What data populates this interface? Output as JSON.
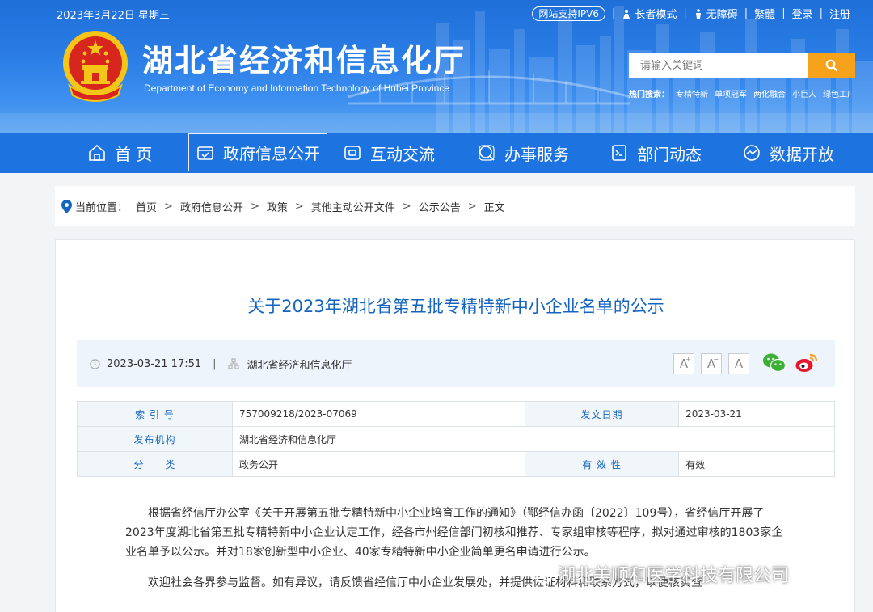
{
  "header": {
    "date": "2023年3月22日 星期三",
    "site_title": "湖北省经济和信息化厅",
    "site_subtitle": "Department of Economy and Information Technology of Hubei Province",
    "ipv6": "网站支持IPV6",
    "links": {
      "elder": "长者模式",
      "accessible": "无障碍",
      "traditional": "繁體",
      "login": "登录",
      "register": "注册"
    },
    "search": {
      "placeholder": "请输入关键词"
    },
    "hot": {
      "label": "热门搜索：",
      "items": [
        "专精特新",
        "单项冠军",
        "两化融合",
        "小巨人",
        "绿色工厂"
      ]
    }
  },
  "nav": {
    "items": [
      "首 页",
      "政府信息公开",
      "互动交流",
      "办事服务",
      "部门动态",
      "数据开放"
    ]
  },
  "breadcrumb": {
    "label": "当前位置：",
    "items": [
      "首页",
      "政府信息公开",
      "政策",
      "其他主动公开文件",
      "公示公告",
      "正文"
    ]
  },
  "article": {
    "title": "关于2023年湖北省第五批专精特新中小企业名单的公示",
    "datetime": "2023-03-21 17:51",
    "source": "湖北省经济和信息化厅",
    "font_buttons": [
      "A",
      "A",
      "A"
    ],
    "info": {
      "index_label": "索 引 号",
      "index_value": "757009218/2023-07069",
      "date_label": "发文日期",
      "date_value": "2023-03-21",
      "org_label": "发布机构",
      "org_value": "湖北省经济和信息化厅",
      "cat_label": "分　　类",
      "cat_value": "政务公开",
      "valid_label": "有 效 性",
      "valid_value": "有效"
    },
    "paragraphs": [
      "根据省经信厅办公室《关于开展第五批专精特新中小企业培育工作的通知》（鄂经信办函〔2022〕109号），省经信厅开展了2023年度湖北省第五批专精特新中小企业认定工作，经各市州经信部门初核和推荐、专家组审核等程序，拟对通过审核的1803家企业名单予以公示。并对18家创新型中小企业、40家专精特新中小企业简单更名申请进行公示。",
      "欢迎社会各界参与监督。如有异议，请反馈省经信厅中小企业发展处，并提供佐证材料和联系方式，以便核实查"
    ]
  },
  "watermark": "湖北美顺和医学科技有限公司",
  "colors": {
    "header_blue": "#2b7ee6",
    "nav_blue": "#1d74e0",
    "title_blue": "#1565c0",
    "search_orange": "#f7a21b"
  }
}
